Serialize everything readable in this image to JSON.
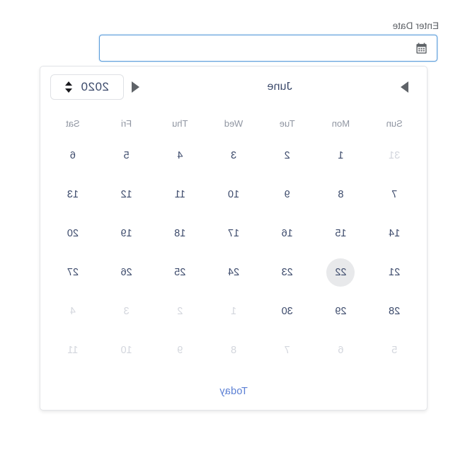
{
  "field": {
    "label": "Enter Date",
    "value": "",
    "placeholder": "",
    "icon": "calendar-icon"
  },
  "calendar": {
    "year": "2020",
    "month": "June",
    "prev_icon": "triangle-left-icon",
    "next_icon": "triangle-right-icon",
    "spinner_up_icon": "chevron-up-icon",
    "spinner_down_icon": "chevron-down-icon",
    "weekdays": [
      "Sun",
      "Mon",
      "Tue",
      "Wed",
      "Thu",
      "Fri",
      "Sat"
    ],
    "weeks": [
      [
        {
          "d": "31",
          "muted": true,
          "today": false
        },
        {
          "d": "1",
          "muted": false,
          "today": false
        },
        {
          "d": "2",
          "muted": false,
          "today": false
        },
        {
          "d": "3",
          "muted": false,
          "today": false
        },
        {
          "d": "4",
          "muted": false,
          "today": false
        },
        {
          "d": "5",
          "muted": false,
          "today": false
        },
        {
          "d": "6",
          "muted": false,
          "today": false
        }
      ],
      [
        {
          "d": "7",
          "muted": false,
          "today": false
        },
        {
          "d": "8",
          "muted": false,
          "today": false
        },
        {
          "d": "9",
          "muted": false,
          "today": false
        },
        {
          "d": "10",
          "muted": false,
          "today": false
        },
        {
          "d": "11",
          "muted": false,
          "today": false
        },
        {
          "d": "12",
          "muted": false,
          "today": false
        },
        {
          "d": "13",
          "muted": false,
          "today": false
        }
      ],
      [
        {
          "d": "14",
          "muted": false,
          "today": false
        },
        {
          "d": "15",
          "muted": false,
          "today": false
        },
        {
          "d": "16",
          "muted": false,
          "today": false
        },
        {
          "d": "17",
          "muted": false,
          "today": false
        },
        {
          "d": "18",
          "muted": false,
          "today": false
        },
        {
          "d": "19",
          "muted": false,
          "today": false
        },
        {
          "d": "20",
          "muted": false,
          "today": false
        }
      ],
      [
        {
          "d": "21",
          "muted": false,
          "today": false
        },
        {
          "d": "22",
          "muted": false,
          "today": true
        },
        {
          "d": "23",
          "muted": false,
          "today": false
        },
        {
          "d": "24",
          "muted": false,
          "today": false
        },
        {
          "d": "25",
          "muted": false,
          "today": false
        },
        {
          "d": "26",
          "muted": false,
          "today": false
        },
        {
          "d": "27",
          "muted": false,
          "today": false
        }
      ],
      [
        {
          "d": "28",
          "muted": false,
          "today": false
        },
        {
          "d": "29",
          "muted": false,
          "today": false
        },
        {
          "d": "30",
          "muted": false,
          "today": false
        },
        {
          "d": "1",
          "muted": true,
          "today": false
        },
        {
          "d": "2",
          "muted": true,
          "today": false
        },
        {
          "d": "3",
          "muted": true,
          "today": false
        },
        {
          "d": "4",
          "muted": true,
          "today": false
        }
      ],
      [
        {
          "d": "5",
          "muted": true,
          "today": false
        },
        {
          "d": "6",
          "muted": true,
          "today": false
        },
        {
          "d": "7",
          "muted": true,
          "today": false
        },
        {
          "d": "8",
          "muted": true,
          "today": false
        },
        {
          "d": "9",
          "muted": true,
          "today": false
        },
        {
          "d": "10",
          "muted": true,
          "today": false
        },
        {
          "d": "11",
          "muted": true,
          "today": false
        }
      ]
    ],
    "today_label": "Today"
  },
  "colors": {
    "focus_border": "#5b9ddb",
    "today_link": "#5b7fd4",
    "day_text": "#3c4a6b",
    "muted_text": "#d3d6dd",
    "today_highlight": "#e8e9eb"
  }
}
